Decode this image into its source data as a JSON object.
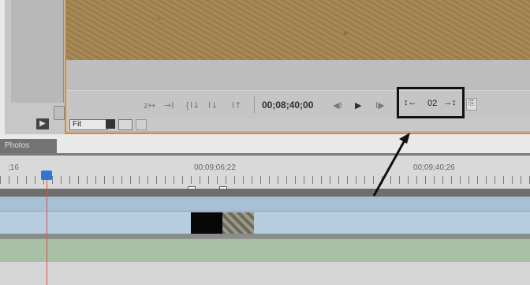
{
  "monitor": {
    "timecode": "00;08;40;00",
    "nav_labels": [
      "z↔",
      "→I",
      "{I↓",
      "I↓",
      "I↑",
      "◀I",
      "▶",
      "I▶"
    ],
    "clip_marker_widget": {
      "value": "02",
      "left_icon": "↕←",
      "right_icon": "→↕"
    },
    "fit_select": "Fit"
  },
  "panel_tab": "Photos",
  "timeline": {
    "ruler_labels": [
      ";16",
      "00;09;06;22",
      "00;09;40;26"
    ],
    "marker_1": "3",
    "marker_2": "3"
  }
}
